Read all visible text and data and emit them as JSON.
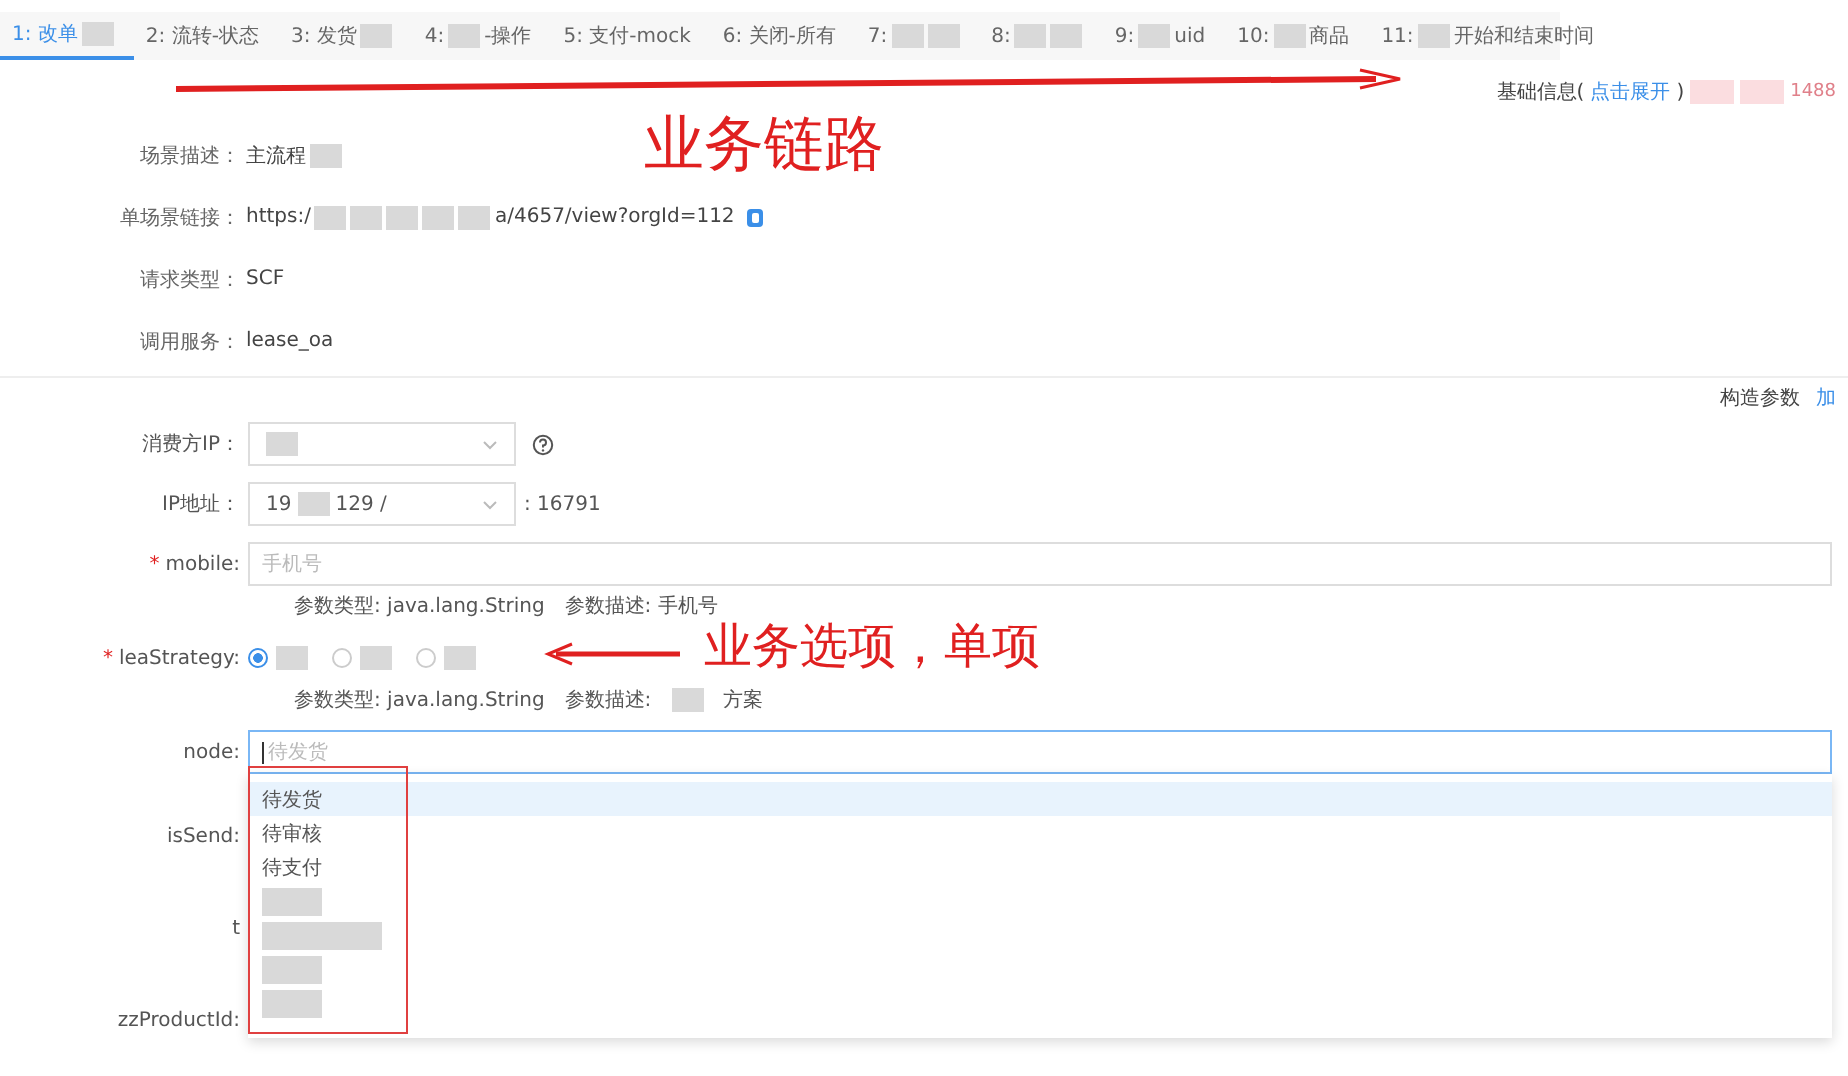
{
  "tabs": [
    {
      "selected": true,
      "parts": [
        {
          "kind": "text",
          "text": "1: 改单"
        },
        {
          "kind": "redacted"
        }
      ]
    },
    {
      "selected": false,
      "parts": [
        {
          "kind": "text",
          "text": "2: 流转-状态"
        }
      ]
    },
    {
      "selected": false,
      "parts": [
        {
          "kind": "text",
          "text": "3: 发货"
        },
        {
          "kind": "redacted"
        }
      ]
    },
    {
      "selected": false,
      "parts": [
        {
          "kind": "text",
          "text": "4:"
        },
        {
          "kind": "redacted"
        },
        {
          "kind": "text",
          "text": "-操作"
        }
      ]
    },
    {
      "selected": false,
      "parts": [
        {
          "kind": "text",
          "text": "5: 支付-mock"
        }
      ]
    },
    {
      "selected": false,
      "parts": [
        {
          "kind": "text",
          "text": "6: 关闭-所有"
        }
      ]
    },
    {
      "selected": false,
      "parts": [
        {
          "kind": "text",
          "text": "7:"
        },
        {
          "kind": "redacted"
        },
        {
          "kind": "redacted"
        }
      ]
    },
    {
      "selected": false,
      "parts": [
        {
          "kind": "text",
          "text": "8:"
        },
        {
          "kind": "redacted"
        },
        {
          "kind": "redacted"
        }
      ]
    },
    {
      "selected": false,
      "parts": [
        {
          "kind": "text",
          "text": "9:"
        },
        {
          "kind": "redacted"
        },
        {
          "kind": "text",
          "text": "uid"
        }
      ]
    },
    {
      "selected": false,
      "parts": [
        {
          "kind": "text",
          "text": "10:"
        },
        {
          "kind": "redacted"
        },
        {
          "kind": "text",
          "text": "商品"
        }
      ]
    },
    {
      "selected": false,
      "parts": [
        {
          "kind": "text",
          "text": "11:"
        },
        {
          "kind": "redacted"
        },
        {
          "kind": "text",
          "text": "开始和结束时间"
        }
      ]
    }
  ],
  "basic_info": {
    "label": "基础信息(",
    "link": "点击展开",
    "close": ")",
    "parts": [
      {
        "kind": "redacted"
      },
      {
        "kind": "redacted"
      },
      {
        "kind": "text",
        "text": "1488"
      }
    ]
  },
  "info_rows": [
    {
      "label": "场景描述：",
      "parts": [
        {
          "kind": "text",
          "text": "主流程"
        },
        {
          "kind": "redacted"
        }
      ]
    },
    {
      "label": "单场景链接：",
      "parts": [
        {
          "kind": "text",
          "text": "https:/"
        },
        {
          "kind": "redacted"
        },
        {
          "kind": "redacted"
        },
        {
          "kind": "redacted"
        },
        {
          "kind": "redacted"
        },
        {
          "kind": "redacted"
        },
        {
          "kind": "text",
          "text": "a/4657/view?orgId=112"
        },
        {
          "kind": "copy-icon"
        }
      ]
    },
    {
      "label": "请求类型：",
      "parts": [
        {
          "kind": "text",
          "text": "SCF"
        }
      ]
    },
    {
      "label": "调用服务：",
      "parts": [
        {
          "kind": "text",
          "text": "lease_oa"
        }
      ]
    }
  ],
  "params_header": {
    "label": "构造参数",
    "action": "加"
  },
  "fields": [
    {
      "kind": "select",
      "label": "消费方IP：",
      "parts": [
        {
          "kind": "redacted"
        }
      ],
      "help": true
    },
    {
      "kind": "select",
      "label": "IP地址：",
      "parts": [
        {
          "kind": "text",
          "text": "19"
        },
        {
          "kind": "redacted"
        },
        {
          "kind": "text",
          "text": "129 /"
        }
      ],
      "after": ": 16791"
    },
    {
      "kind": "input",
      "label": "mobile:",
      "required_mark": "*",
      "placeholder": "手机号",
      "hint": [
        {
          "kind": "text",
          "text": "参数类型: java.lang.String"
        },
        {
          "kind": "text",
          "text": "参数描述: 手机号"
        }
      ]
    },
    {
      "kind": "radio",
      "label": "leaStrategy:",
      "required_mark": "*",
      "options": [
        {
          "selected": true
        },
        {
          "selected": false
        },
        {
          "selected": false
        }
      ],
      "hint": [
        {
          "kind": "text",
          "text": "参数类型: java.lang.String"
        },
        {
          "kind": "text",
          "text": "参数描述:"
        },
        {
          "kind": "redacted"
        },
        {
          "kind": "text",
          "text": "方案"
        }
      ]
    },
    {
      "kind": "input",
      "label": "node:",
      "focused": true,
      "placeholder": "待发货",
      "dropdown": [
        {
          "selected": true,
          "parts": [
            {
              "kind": "text",
              "text": "待发货"
            }
          ]
        },
        {
          "selected": false,
          "parts": [
            {
              "kind": "text",
              "text": "待审核"
            }
          ]
        },
        {
          "selected": false,
          "parts": [
            {
              "kind": "text",
              "text": "待支付"
            }
          ]
        },
        {
          "selected": false,
          "parts": [
            {
              "kind": "redacted"
            }
          ]
        },
        {
          "selected": false,
          "parts": [
            {
              "kind": "redacted"
            },
            {
              "kind": "redacted"
            }
          ]
        },
        {
          "selected": false,
          "parts": [
            {
              "kind": "redacted"
            }
          ]
        },
        {
          "selected": false,
          "parts": [
            {
              "kind": "redacted"
            }
          ]
        }
      ]
    },
    {
      "kind": "label",
      "label": "isSend:"
    },
    {
      "kind": "label",
      "label": "t"
    },
    {
      "kind": "label",
      "label": "zzProductId:"
    }
  ],
  "annotations": {
    "chain": "业务链路",
    "option": "业务选项，单项"
  }
}
